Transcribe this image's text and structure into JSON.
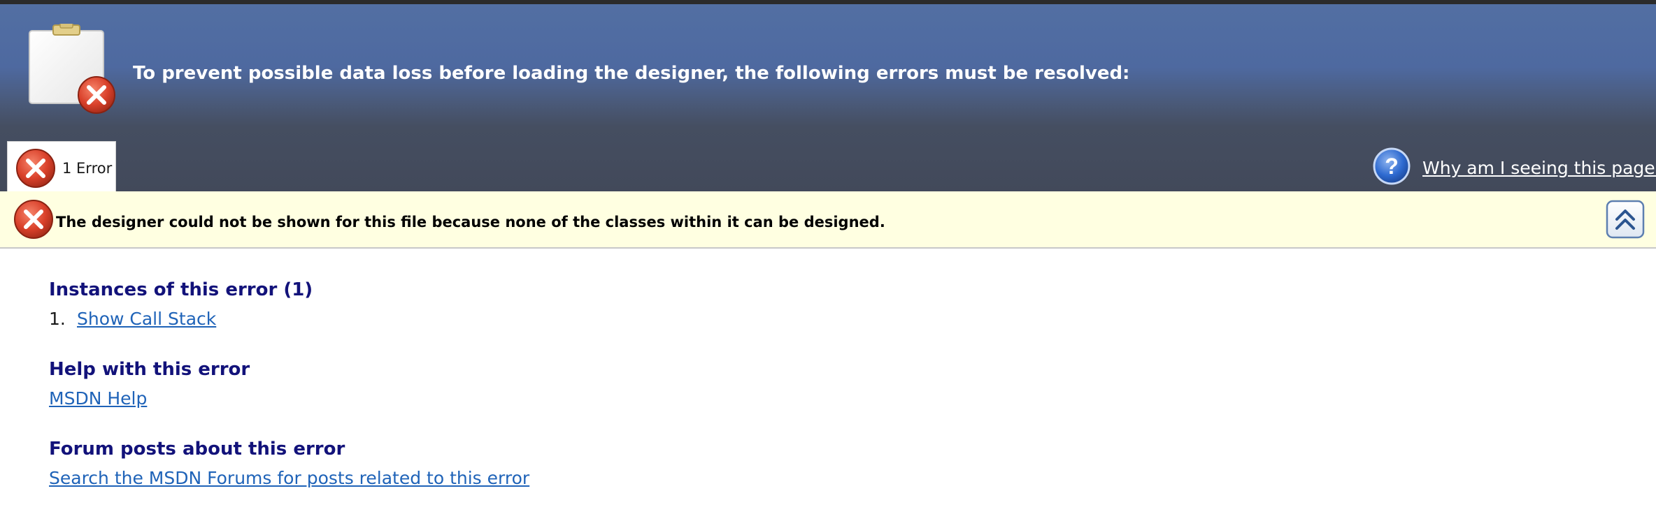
{
  "header": {
    "message": "To prevent possible data loss before loading the designer, the following errors must be resolved:",
    "icon": "clipboard-error-icon"
  },
  "tab": {
    "label": "1 Error",
    "icon": "error-icon"
  },
  "help": {
    "link_text": "Why am I seeing this page?",
    "icon": "help-icon"
  },
  "error_banner": {
    "message": "The designer could not be shown for this file because none of the classes within it can be designed.",
    "icon": "error-icon",
    "collapse_icon": "collapse-icon"
  },
  "sections": {
    "instances": {
      "heading": "Instances of this error (1)",
      "items": [
        {
          "number": "1.",
          "link": "Show Call Stack"
        }
      ]
    },
    "help": {
      "heading": "Help with this error",
      "link": "MSDN Help"
    },
    "forum": {
      "heading": "Forum posts about this error",
      "link": "Search the MSDN Forums for posts related to this error"
    }
  },
  "colors": {
    "header_blue": "#526fa3",
    "header_dark": "#42495a",
    "banner_bg": "#ffffe1",
    "heading": "#12127a",
    "link": "#1f63b8",
    "error_red": "#d9402a"
  }
}
